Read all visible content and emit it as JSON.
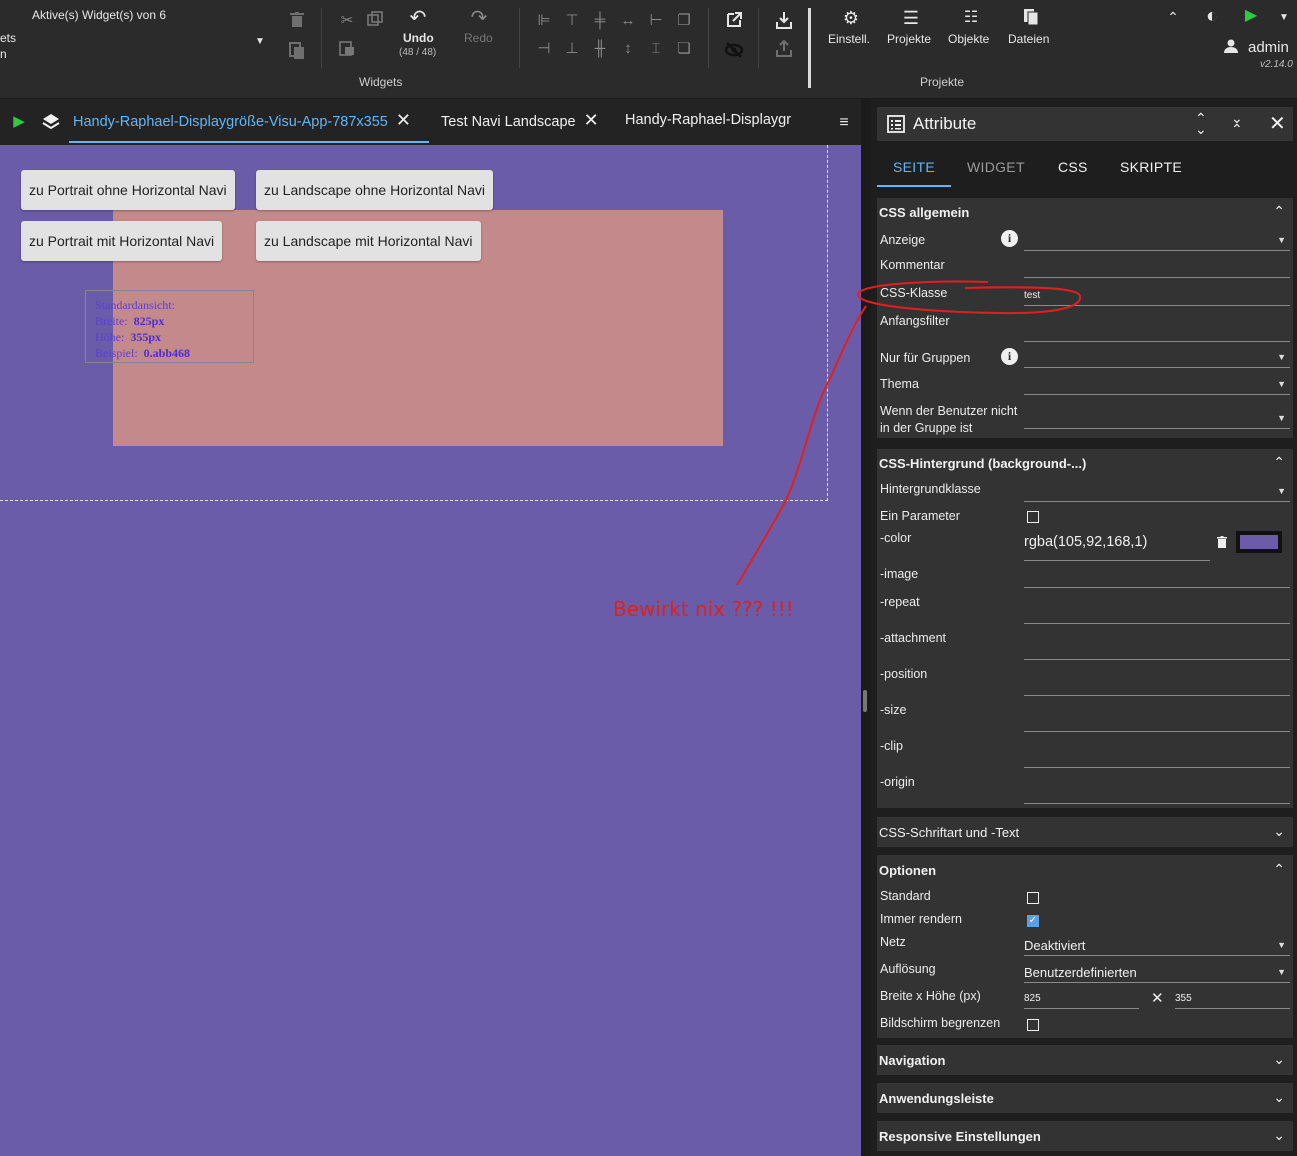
{
  "toolbar": {
    "active_widgets": "Aktive(s) Widget(s) von 6",
    "left_cut_1": "ets",
    "left_cut_2": "n",
    "undo_label": "Undo",
    "undo_count": "(48 / 48)",
    "redo_label": "Redo",
    "widgets_group": "Widgets",
    "settings_label": "Einstell.",
    "projects_label": "Projekte",
    "objects_label": "Objekte",
    "files_label": "Dateien",
    "projects_group": "Projekte",
    "user": "admin",
    "version": "v2.14.0",
    "play_color": "#2ecc40"
  },
  "tabs": [
    {
      "label": "Handy-Raphael-Displaygröße-Visu-App-787x355",
      "active": true
    },
    {
      "label": "Test Navi Landscape",
      "active": false
    },
    {
      "label": "Handy-Raphael-Displaygr",
      "active": false
    }
  ],
  "canvas": {
    "background": "#6a5ca9",
    "buttons": [
      "zu Portrait ohne Horizontal Navi",
      "zu Landscape ohne Horizontal Navi",
      "zu Portrait mit Horizontal Navi",
      "zu Landscape mit Horizontal Navi"
    ],
    "info": {
      "title": "Standardansicht:",
      "width_label": "Breite:",
      "width_value": "825px",
      "height_label": "Höhe:",
      "height_value": "355px",
      "example_label": "Beispiel:",
      "example_value": "0.abb468"
    },
    "annotation": "Bewirkt nix ??? !!!"
  },
  "panel": {
    "title": "Attribute",
    "tabs": [
      "SEITE",
      "WIDGET",
      "CSS",
      "SKRIPTE"
    ],
    "css_general": {
      "header": "CSS allgemein",
      "display": "Anzeige",
      "comment": "Kommentar",
      "css_class": "CSS-Klasse",
      "css_class_value": "test",
      "initial_filter": "Anfangsfilter",
      "only_groups": "Nur für Gruppen",
      "theme": "Thema",
      "not_in_group_1": "Wenn der Benutzer nicht",
      "not_in_group_2": "in der Gruppe ist"
    },
    "css_background": {
      "header": "CSS-Hintergrund (background-...)",
      "bg_class": "Hintergrundklasse",
      "one_param": "Ein Parameter",
      "color": "-color",
      "color_value": "rgba(105,92,168,1)",
      "image": "-image",
      "repeat": "-repeat",
      "attachment": "-attachment",
      "position": "-position",
      "size": "-size",
      "clip": "-clip",
      "origin": "-origin"
    },
    "css_font": {
      "header": "CSS-Schriftart und -Text"
    },
    "options": {
      "header": "Optionen",
      "standard": "Standard",
      "always_render": "Immer rendern",
      "always_render_checked": true,
      "grid": "Netz",
      "grid_value": "Deaktiviert",
      "resolution": "Auflösung",
      "resolution_value": "Benutzerdefinierten",
      "size_label": "Breite x Höhe (px)",
      "width": "825",
      "height": "355",
      "limit_screen": "Bildschirm begrenzen"
    },
    "navigation": {
      "header": "Navigation"
    },
    "app_bar": {
      "header": "Anwendungsleiste"
    },
    "responsive": {
      "header": "Responsive Einstellungen"
    }
  }
}
